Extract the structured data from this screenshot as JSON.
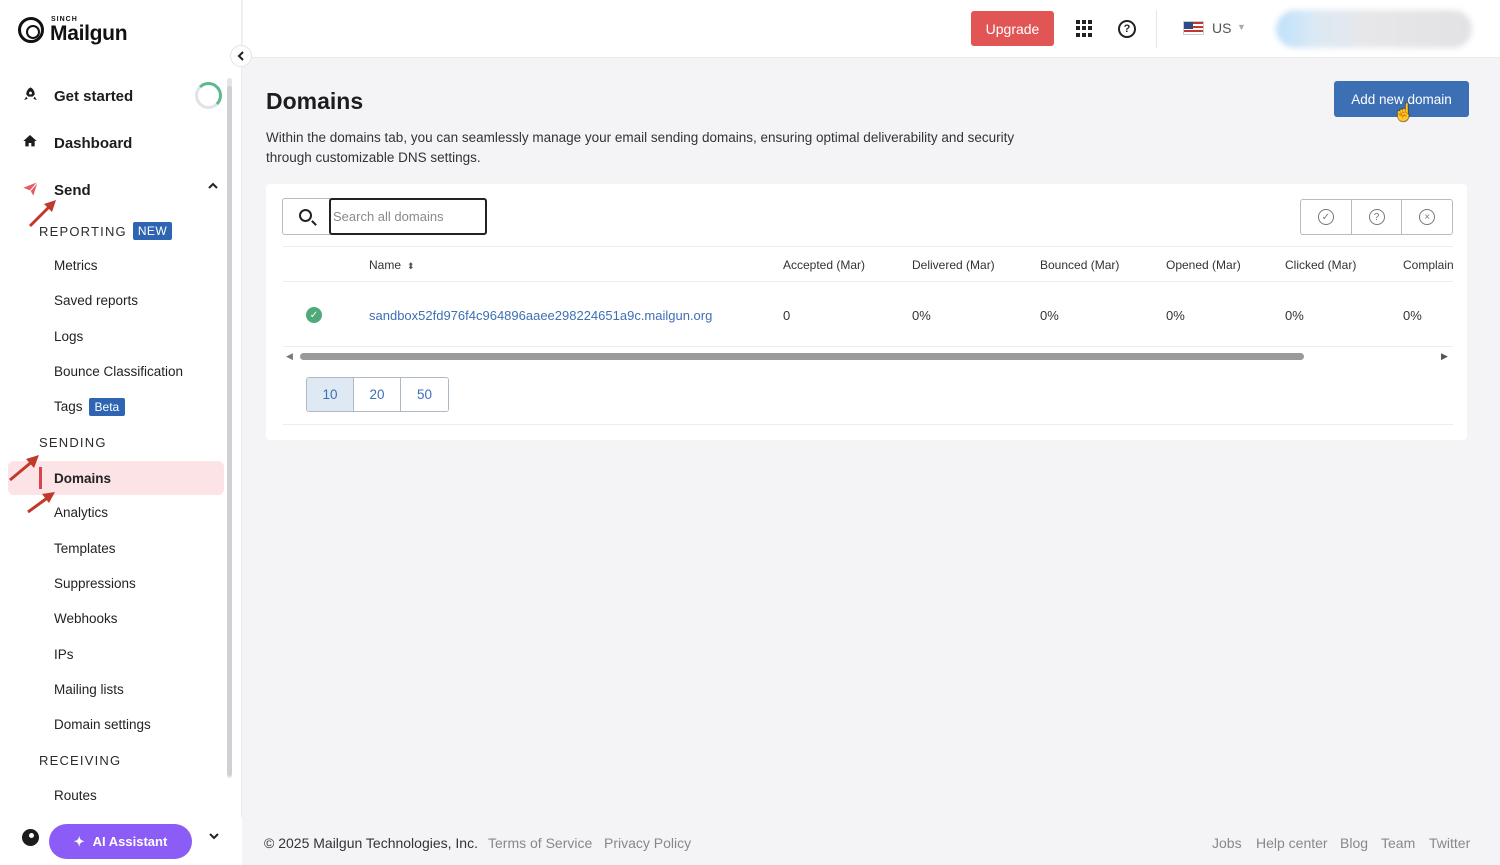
{
  "brand": {
    "sinch": "SINCH",
    "name": "Mailgun"
  },
  "sidebar": {
    "collapse_icon": "chevron-left-icon",
    "get_started": "Get started",
    "dashboard": "Dashboard",
    "send": "Send",
    "reporting_label": "REPORTING",
    "reporting_badge": "NEW",
    "reporting_items": [
      "Metrics",
      "Saved reports",
      "Logs",
      "Bounce Classification",
      "Tags"
    ],
    "tags_badge": "Beta",
    "sending_label": "SENDING",
    "sending_items": [
      "Domains",
      "Analytics",
      "Templates",
      "Suppressions",
      "Webhooks",
      "IPs",
      "Mailing lists",
      "Domain settings"
    ],
    "active_item": "Domains",
    "receiving_label": "RECEIVING",
    "receiving_items": [
      "Routes"
    ],
    "ai_assistant": "AI Assistant"
  },
  "topbar": {
    "upgrade": "Upgrade",
    "region": "US"
  },
  "main": {
    "title": "Domains",
    "description": "Within the domains tab, you can seamlessly manage your email sending domains, ensuring optimal deliverability and security through customizable DNS settings.",
    "add_button": "Add new domain",
    "search_placeholder": "Search all domains",
    "filters": [
      "check-circle-icon",
      "question-circle-icon",
      "x-circle-icon"
    ],
    "columns": [
      "Name",
      "Accepted (Mar)",
      "Delivered (Mar)",
      "Bounced (Mar)",
      "Opened (Mar)",
      "Clicked (Mar)",
      "Complain"
    ],
    "rows": [
      {
        "status": "verified",
        "name": "sandbox52fd976f4c964896aaee298224651a9c.mailgun.org",
        "accepted": "0",
        "delivered": "0%",
        "bounced": "0%",
        "opened": "0%",
        "clicked": "0%",
        "complain": "0%"
      }
    ],
    "page_sizes": [
      "10",
      "20",
      "50"
    ],
    "selected_page_size": "10"
  },
  "footer": {
    "copyright": "© 2025 Mailgun Technologies, Inc.",
    "terms": "Terms of Service",
    "privacy": "Privacy Policy",
    "links": [
      "Jobs",
      "Help center",
      "Blog",
      "Team",
      "Twitter"
    ]
  },
  "colors": {
    "accent": "#3d6fb5",
    "upgrade": "#e25555",
    "active_bg": "#fbe3e6",
    "ai": "#8b5cf6",
    "annotation": "#c0392b"
  }
}
